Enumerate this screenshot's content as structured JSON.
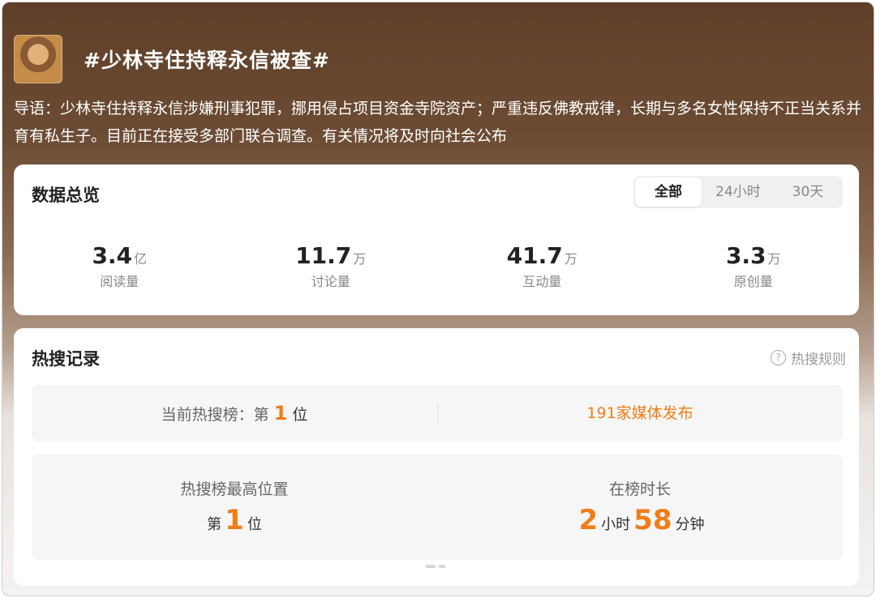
{
  "header": {
    "title": "#少林寺住持释永信被查#",
    "intro": "导语：少林寺住持释永信涉嫌刑事犯罪，挪用侵占项目资金寺院资产；严重违反佛教戒律，长期与多名女性保持不正当关系并育有私生子。目前正在接受多部门联合调查。有关情况将及时向社会公布"
  },
  "overview": {
    "title": "数据总览",
    "tabs": [
      {
        "label": "全部",
        "active": true
      },
      {
        "label": "24小时",
        "active": false
      },
      {
        "label": "30天",
        "active": false
      }
    ],
    "stats": [
      {
        "value": "3.4",
        "unit": "亿",
        "label": "阅读量"
      },
      {
        "value": "11.7",
        "unit": "万",
        "label": "讨论量"
      },
      {
        "value": "41.7",
        "unit": "万",
        "label": "互动量"
      },
      {
        "value": "3.3",
        "unit": "万",
        "label": "原创量"
      }
    ]
  },
  "hot": {
    "title": "热搜记录",
    "rule_label": "热搜规则",
    "rule_icon": "question-circle-icon",
    "current_prefix": "当前热搜榜：第",
    "current_rank": "1",
    "current_suffix": "位",
    "media": "191家媒体发布",
    "peak_label": "热搜榜最高位置",
    "peak_prefix": "第",
    "peak_rank": "1",
    "peak_suffix": "位",
    "duration_label": "在榜时长",
    "duration_hours": "2",
    "duration_hours_unit": "小时",
    "duration_minutes": "58",
    "duration_minutes_unit": "分钟"
  },
  "colors": {
    "accent": "#f07d1a",
    "header_brown": "#5f3f29"
  }
}
